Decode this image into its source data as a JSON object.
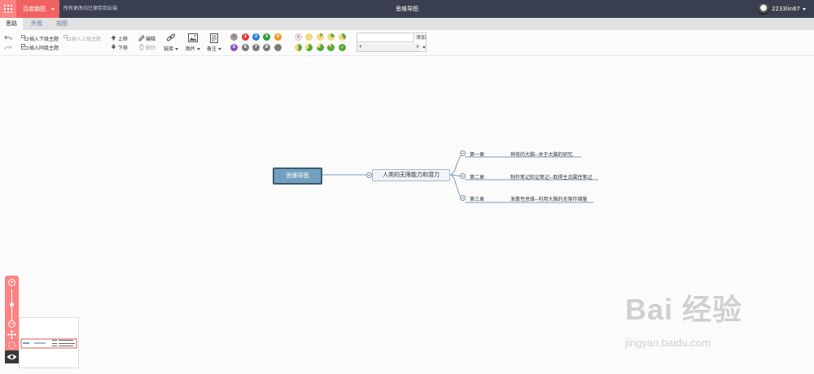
{
  "topbar": {
    "brand": "百度脑图",
    "save_status": "所有更改均已保存到云端",
    "title": "思维导图",
    "username": "2233lin67"
  },
  "tabs": [
    {
      "label": "思路",
      "active": true
    },
    {
      "label": "外观",
      "active": false
    },
    {
      "label": "视图",
      "active": false
    }
  ],
  "toolbar": {
    "insert_child": "插入下级主题",
    "insert_parent": "插入上级主题",
    "insert_sibling": "插入同级主题",
    "move_up": "上移",
    "move_down": "下移",
    "edit": "编辑",
    "delete": "删除",
    "link": "链接",
    "image": "图片",
    "note": "备注",
    "priorities": [
      "1",
      "2",
      "3",
      "4",
      "5",
      "6",
      "7",
      "8"
    ],
    "add_label": "添加",
    "colors": {
      "accent": "#fc8383",
      "brand": "#f06362",
      "topbar": "#393f4f"
    }
  },
  "mindmap": {
    "root": "思维导图",
    "main_topic": "人类的无限能力和潜力",
    "chapters": [
      {
        "title": "第一章",
        "desc": "神奇的大脑--关于大脑的研究"
      },
      {
        "title": "第二章",
        "desc": "制作笔记和记笔记--取得主流属性笔记"
      },
      {
        "title": "第三章",
        "desc": "发散性思维--利用大脑的无限存储量"
      }
    ]
  },
  "zoom": {
    "zoom_in": "+",
    "zoom_out": "−"
  },
  "watermark": {
    "text": "Bai 经验",
    "url": "jingyan.baidu.com"
  }
}
